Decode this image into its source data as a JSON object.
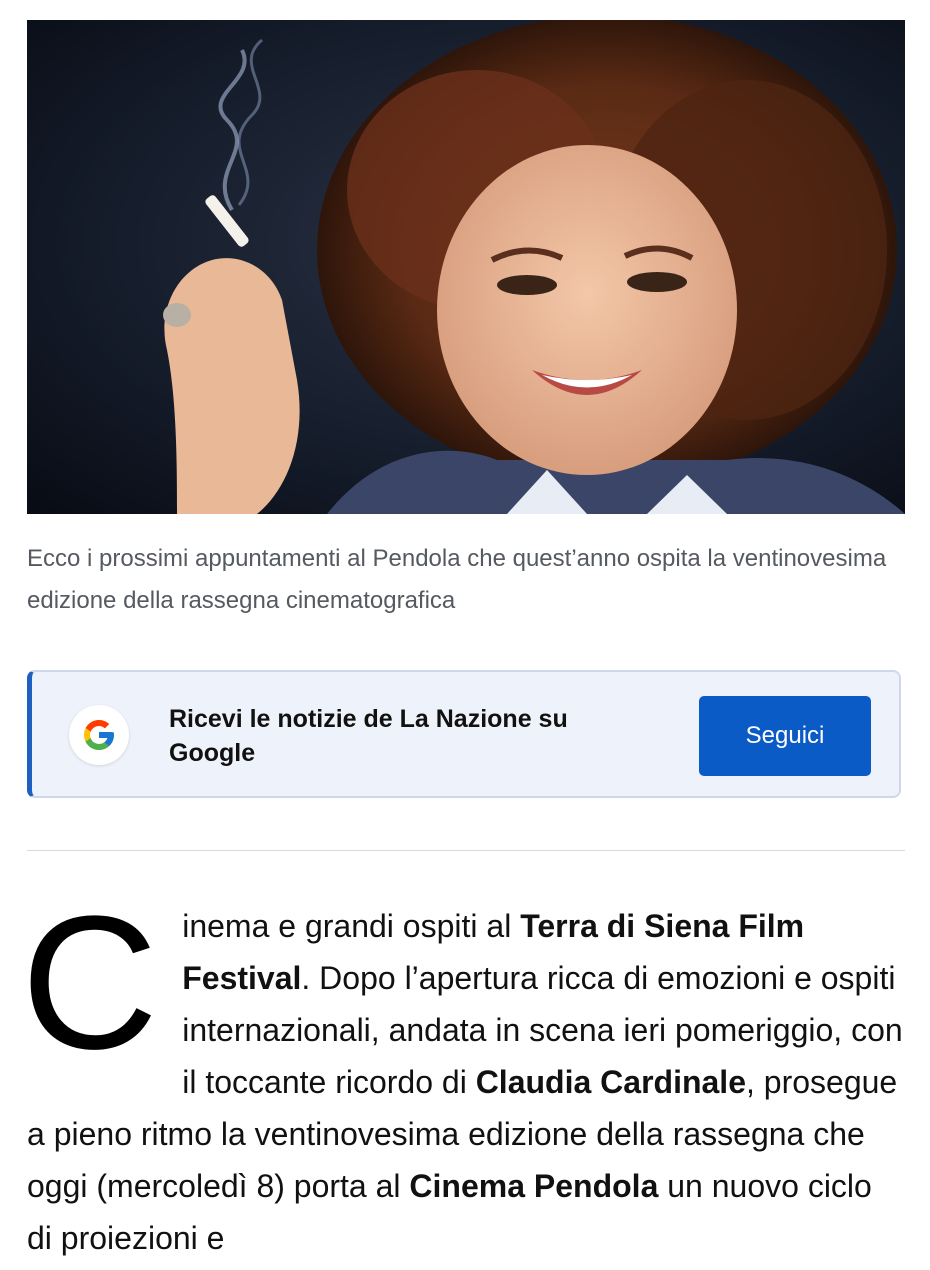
{
  "hero": {
    "image_description_icon": "photo-icon"
  },
  "caption": "Ecco i prossimi appuntamenti al Pendola che quest’anno ospita la ventinovesima edizione della rassegna cinematografica",
  "follow_box": {
    "text": "Ricevi le notizie de La Nazione su Google",
    "button_label": "Seguici",
    "icon": "google-g-icon",
    "accent_color": "#1f5fbf",
    "button_color": "#0b5bc7",
    "background_color": "#eef2fb"
  },
  "article": {
    "dropcap": "C",
    "segments": [
      {
        "text": "inema e grandi ospiti al ",
        "bold": false
      },
      {
        "text": "Terra di Siena Film Festival",
        "bold": true
      },
      {
        "text": ". Dopo l’apertura ricca di emozioni e ospiti internazionali, andata in scena ieri pomeriggio, con il toccante ricordo di ",
        "bold": false
      },
      {
        "text": "Claudia Cardinale",
        "bold": true
      },
      {
        "text": ", prosegue a pieno ritmo la ventinovesima edizione della rassegna che oggi (mercoledì 8) porta al ",
        "bold": false
      },
      {
        "text": "Cinema Pendola",
        "bold": true
      },
      {
        "text": " un nuovo ciclo di proiezioni e",
        "bold": false
      }
    ]
  }
}
